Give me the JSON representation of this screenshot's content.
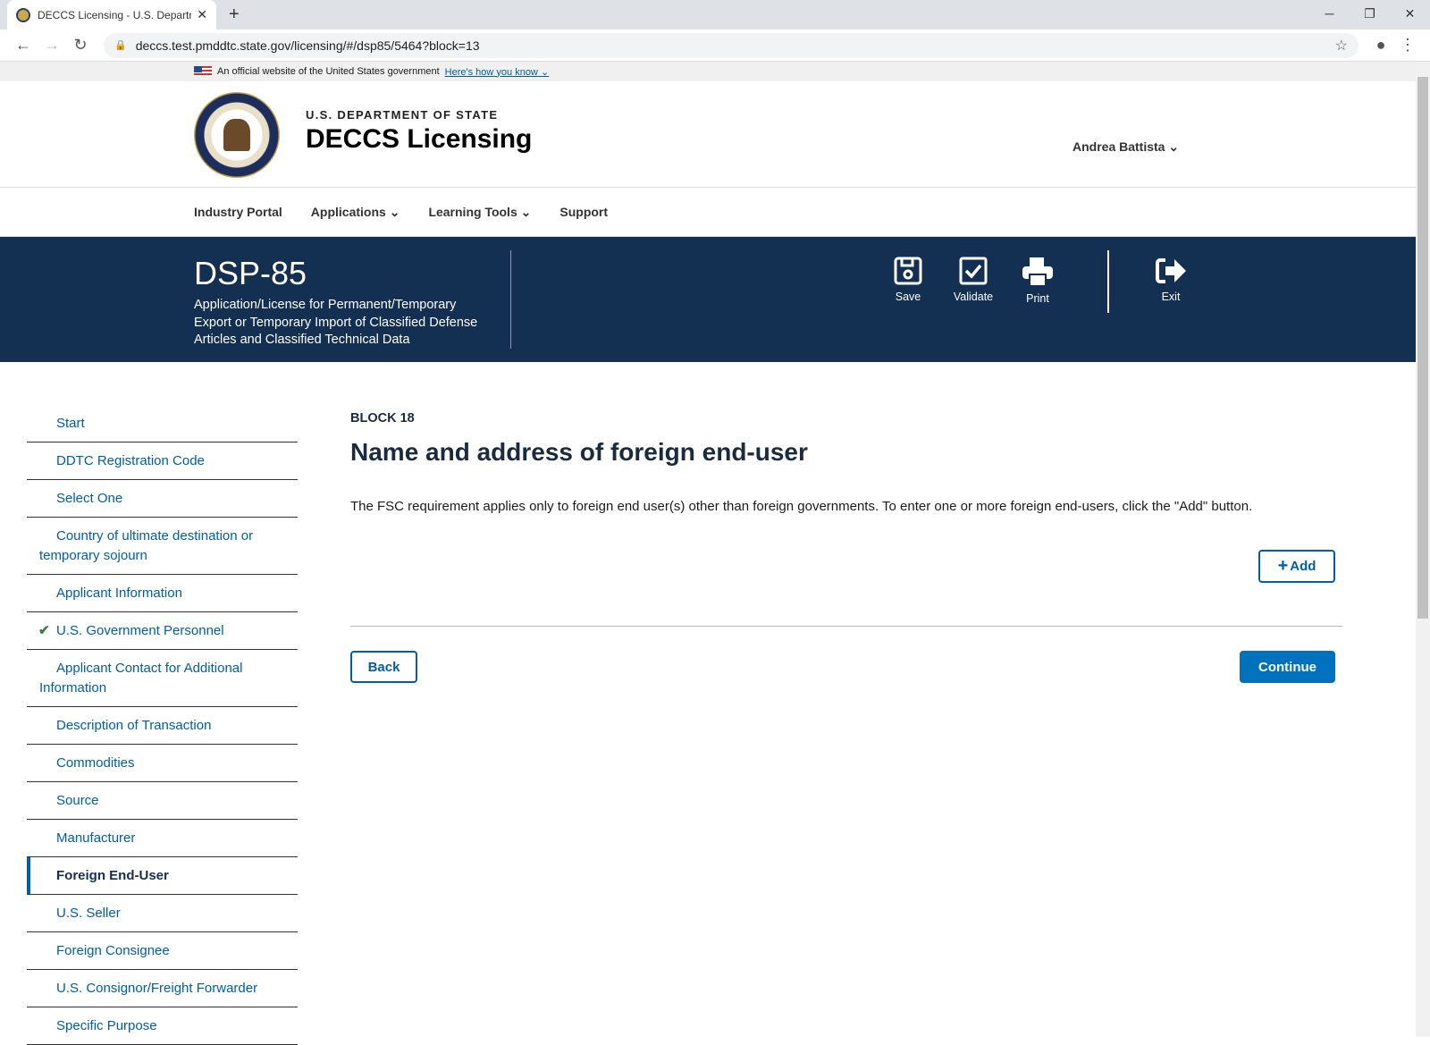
{
  "browser": {
    "tab_title": "DECCS Licensing - U.S. Departme",
    "url": "deccs.test.pmddtc.state.gov/licensing/#/dsp85/5464?block=13"
  },
  "gov_banner": {
    "text": "An official website of the United States government",
    "link": "Here's how you know"
  },
  "header": {
    "dept": "U.S. DEPARTMENT OF STATE",
    "site": "DECCS Licensing",
    "user": "Andrea Battista"
  },
  "nav": [
    "Industry Portal",
    "Applications",
    "Learning Tools",
    "Support"
  ],
  "banner": {
    "form_id": "DSP-85",
    "form_desc": "Application/License for Permanent/Temporary Export or Temporary Import of Classified Defense Articles and Classified Technical Data",
    "tools": {
      "save": "Save",
      "validate": "Validate",
      "print": "Print",
      "exit": "Exit"
    }
  },
  "sidebar": [
    {
      "label": "Start"
    },
    {
      "label": "DDTC Registration Code"
    },
    {
      "label": "Select One"
    },
    {
      "label": "Country of ultimate destination or temporary sojourn"
    },
    {
      "label": "Applicant Information"
    },
    {
      "label": "U.S. Government Personnel",
      "complete": true
    },
    {
      "label": "Applicant Contact for Additional Information"
    },
    {
      "label": "Description of Transaction"
    },
    {
      "label": "Commodities"
    },
    {
      "label": "Source"
    },
    {
      "label": "Manufacturer"
    },
    {
      "label": "Foreign End-User",
      "active": true
    },
    {
      "label": "U.S. Seller"
    },
    {
      "label": "Foreign Consignee"
    },
    {
      "label": "U.S. Consignor/Freight Forwarder"
    },
    {
      "label": "Specific Purpose"
    }
  ],
  "main": {
    "block": "BLOCK 18",
    "title": "Name and address of foreign end-user",
    "instructions": "The FSC requirement applies only to foreign end user(s) other than foreign governments. To enter one or more foreign end-users, click the \"Add\" button.",
    "add": "Add",
    "back": "Back",
    "continue": "Continue"
  }
}
